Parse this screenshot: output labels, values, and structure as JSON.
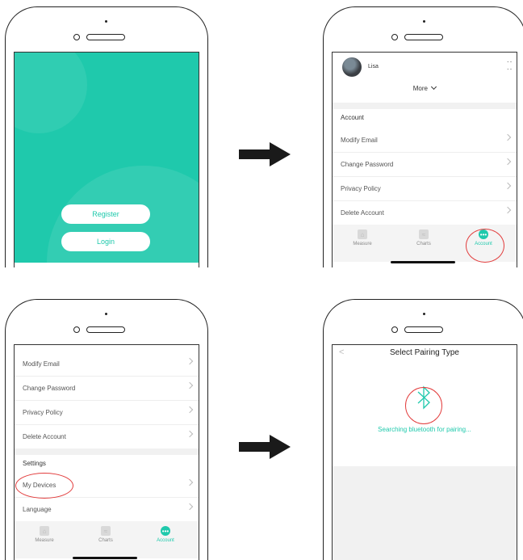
{
  "screen1": {
    "register_label": "Register",
    "login_label": "Login"
  },
  "screen2": {
    "user_name": "Lisa",
    "user_value": "- -\n- -",
    "more_label": "More",
    "account_heading": "Account",
    "rows": [
      "Modify Email",
      "Change Password",
      "Privacy Policy",
      "Delete Account"
    ]
  },
  "screen3": {
    "rows": [
      "Modify Email",
      "Change Password",
      "Privacy Policy",
      "Delete Account"
    ],
    "settings_heading": "Settings",
    "settings_rows": [
      "My Devices",
      "Language"
    ]
  },
  "tabs": {
    "measure": "Measure",
    "charts": "Charts",
    "account": "Account"
  },
  "screen4": {
    "back_glyph": "<",
    "title": "Select Pairing Type",
    "status": "Searching bluetooth for pairing..."
  },
  "colors": {
    "accent": "#1fc9ac",
    "highlight": "#e23c3c"
  }
}
